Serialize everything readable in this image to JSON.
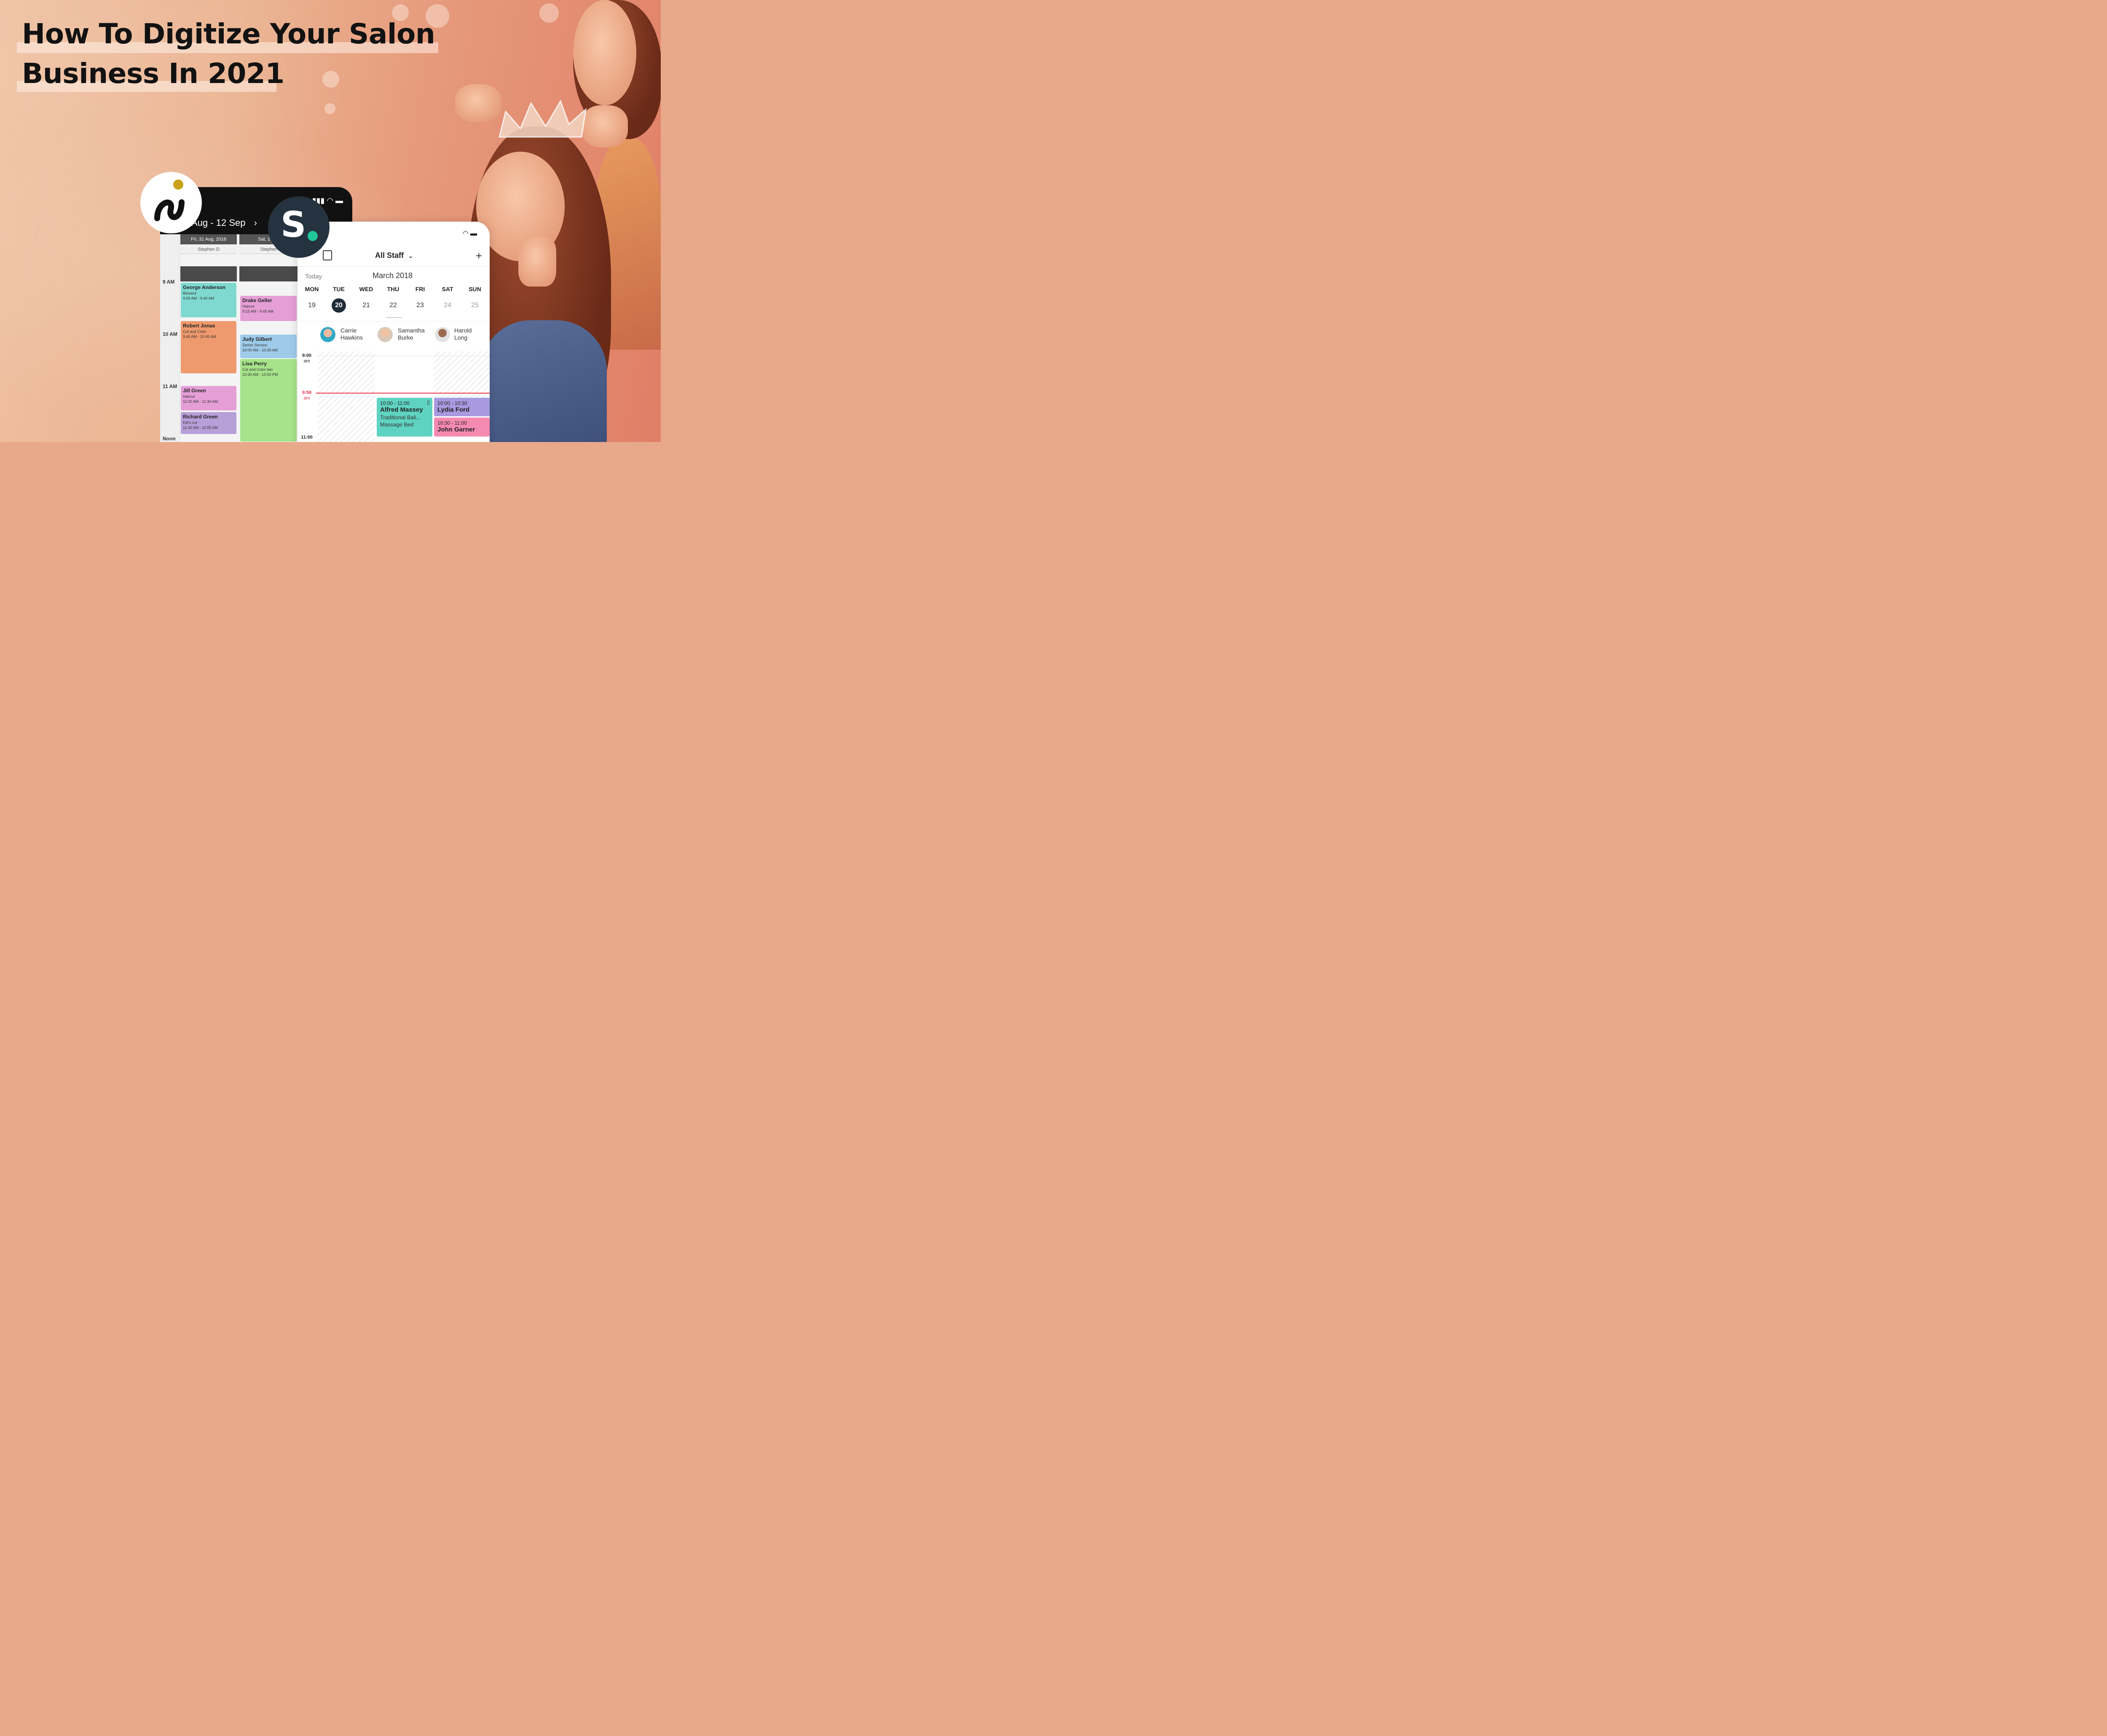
{
  "headline": {
    "line1": "How To Digitize Your Salon",
    "line2": "Business In 2021"
  },
  "logos": {
    "left_logo_icon": "s-swirl-logo-icon",
    "right_logo": "S.",
    "accent_dot_color": "#1fc79a"
  },
  "left_app": {
    "date_range": "Aug - 12 Sep",
    "next_icon": "chevron-right-icon",
    "columns": [
      {
        "date": "Fri, 31 Aug, 2018",
        "staff": "Stephen D"
      },
      {
        "date": "Sat, 1 Sep",
        "staff": "Stephen"
      }
    ],
    "times": [
      "9 AM",
      "10 AM",
      "11 AM",
      "Noon"
    ],
    "appointments": [
      {
        "name": "George Anderson",
        "service": "Blowout",
        "time": "9:00 AM - 9:40 AM",
        "color": "#7fd9d0"
      },
      {
        "name": "Robert Jonas",
        "service": "Cut and Color",
        "time": "9:45 AM - 10:45 AM",
        "color": "#ef9a6e"
      },
      {
        "name": "Jill Green",
        "service": "Haircut",
        "time": "11:00 AM - 11:30 AM",
        "color": "#e59fd6"
      },
      {
        "name": "Richard Green",
        "service": "Kid's cut",
        "time": "11:30 AM - 11:55 AM",
        "color": "#b79fd8"
      },
      {
        "name": "Drake Geller",
        "service": "Haircut",
        "time": "9:15 AM - 9:45 AM",
        "color": "#e59fd6"
      },
      {
        "name": "Judy Gilbert",
        "service": "Senior Service",
        "time": "10:00 AM - 10:30 AM",
        "color": "#9fcbea"
      },
      {
        "name": "Lisa Perry",
        "service": "Cut and Color two",
        "time": "10:30 AM - 12:00 PM",
        "color": "#a6e38a"
      }
    ]
  },
  "right_app": {
    "staff_selector": "All Staff",
    "today_label": "Today",
    "month": "March 2018",
    "days": [
      {
        "name": "MON",
        "date": "19"
      },
      {
        "name": "TUE",
        "date": "20"
      },
      {
        "name": "WED",
        "date": "21"
      },
      {
        "name": "THU",
        "date": "22"
      },
      {
        "name": "FRI",
        "date": "23"
      },
      {
        "name": "SAT",
        "date": "24"
      },
      {
        "name": "SUN",
        "date": "25"
      }
    ],
    "selected_day": "20",
    "staff": [
      {
        "first": "Carrie",
        "last": "Hawkins"
      },
      {
        "first": "Samantha",
        "last": "Burke"
      },
      {
        "first": "Harold",
        "last": "Long"
      }
    ],
    "time_labels": [
      {
        "time": "9:00",
        "ampm": "am"
      },
      {
        "time": "9:58",
        "ampm": "am"
      },
      {
        "time": "11:00",
        "ampm": ""
      }
    ],
    "now_color": "#e8334a",
    "appointments": [
      {
        "time": "10:00 - 11:00",
        "name": "Alfred Massey",
        "detail1": "Traditional Bali...",
        "detail2": "Massage Bed",
        "color": "#5fd3c1"
      },
      {
        "time": "10:00 - 10:30",
        "name": "Lydia Ford",
        "color": "#a89ae0"
      },
      {
        "time": "10:30 - 11:00",
        "name": "John Garner",
        "color": "#f58ab1"
      }
    ]
  }
}
